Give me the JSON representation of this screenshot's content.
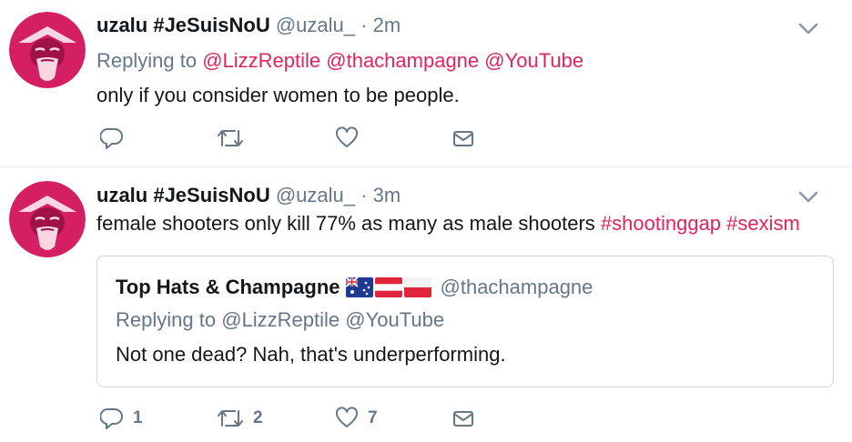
{
  "tweets": [
    {
      "author_name": "uzalu #JeSuisNoU",
      "author_handle": "@uzalu_",
      "separator": " · ",
      "time": "2m",
      "replying_prefix": "Replying to",
      "replying_to": [
        "@LizzReptile",
        "@thachampagne",
        "@YouTube"
      ],
      "text": "only if you consider women to be people.",
      "counts": {
        "reply": "",
        "retweet": "",
        "like": ""
      }
    },
    {
      "author_name": "uzalu #JeSuisNoU",
      "author_handle": "@uzalu_",
      "separator": " · ",
      "time": "3m",
      "text_plain": "female shooters only kill 77% as many as male shooters ",
      "hashtags": [
        "#shootinggap",
        "#sexism"
      ],
      "quoted": {
        "author_name": "Top Hats & Champagne",
        "flags": [
          "australia-flag",
          "austria-flag",
          "poland-flag"
        ],
        "author_handle": "@thachampagne",
        "replying_prefix": "Replying to",
        "replying_to": [
          "@LizzReptile",
          "@YouTube"
        ],
        "text": "Not one dead? Nah, that's underperforming."
      },
      "counts": {
        "reply": "1",
        "retweet": "2",
        "like": "7"
      }
    }
  ],
  "colors": {
    "accent": "#e0245e",
    "secondary_text": "#657786",
    "primary_text": "#14171a",
    "divider": "#e6ecf0",
    "avatar_bg": "#d41f63"
  },
  "icons": [
    "reply-icon",
    "retweet-icon",
    "like-icon",
    "direct-message-icon",
    "chevron-down-icon"
  ]
}
